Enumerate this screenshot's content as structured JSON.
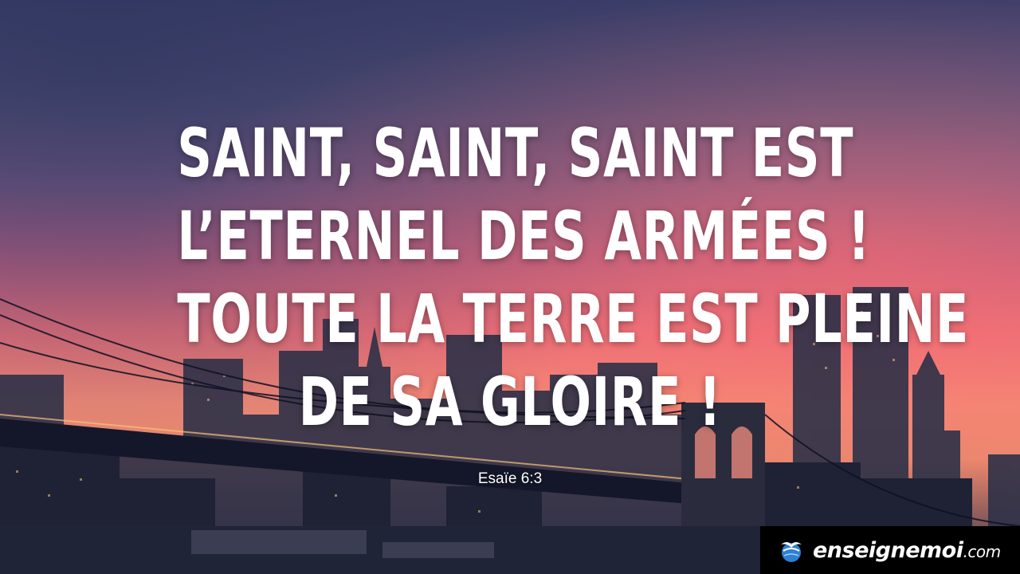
{
  "verse": {
    "lines": [
      "SAINT, SAINT, SAINT EST",
      "L’ETERNEL DES ARMÉES !",
      "TOUTE LA TERRE EST PLEINE",
      "DE SA GLOIRE !"
    ],
    "reference": "Esaïe 6:3"
  },
  "brand": {
    "name": "enseignemoi",
    "suffix": ".com",
    "icon": "globe-bird-icon"
  },
  "colors": {
    "text": "#ffffff",
    "logo_background": "#000000",
    "sky_top": "#3e3f6a",
    "sky_glow": "#f28a76"
  }
}
